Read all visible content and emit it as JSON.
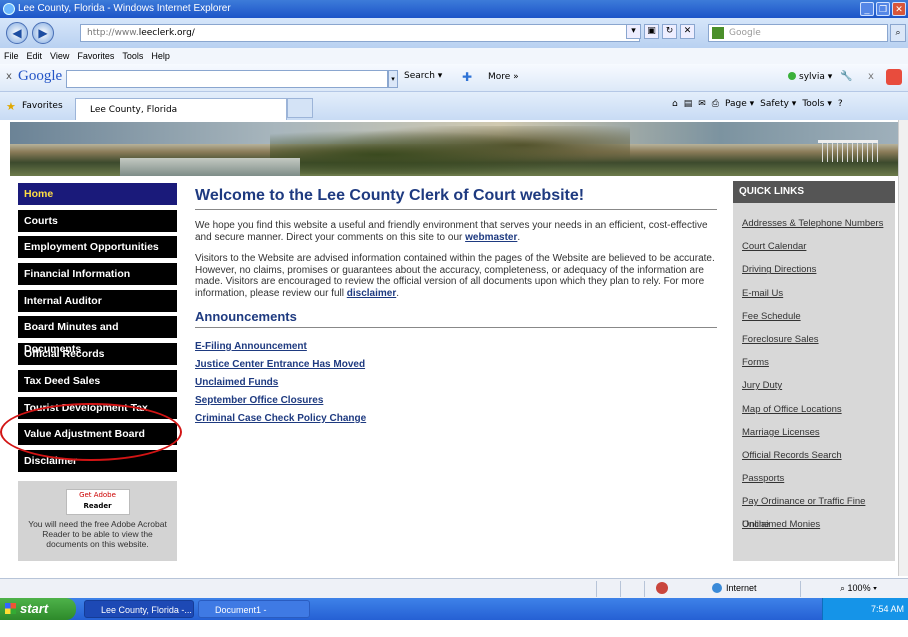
{
  "window": {
    "title": "Lee County, Florida - Windows Internet Explorer",
    "controls": [
      "_",
      "❐",
      "✕"
    ]
  },
  "address_bar": {
    "url_prefix": "http://www.",
    "url_host": "leeclerk.org/",
    "search_placeholder": "Google"
  },
  "menu": [
    "File",
    "Edit",
    "View",
    "Favorites",
    "Tools",
    "Help"
  ],
  "google_bar": {
    "logo": "Google",
    "search_label": "Search ▾",
    "more_label": "More »",
    "user": "sylvia ▾"
  },
  "favorites_bar": {
    "favorites_label": "Favorites",
    "tab_title": "Lee County, Florida",
    "commands": [
      "Page ▾",
      "Safety ▾",
      "Tools ▾"
    ]
  },
  "left_nav": {
    "items": [
      "Home",
      "Courts",
      "Employment Opportunities",
      "Financial Information",
      "Internal Auditor",
      "Board Minutes and Documents",
      "Official Records",
      "Tax Deed Sales",
      "Tourist Development Tax",
      "Value Adjustment Board",
      "Disclaimer"
    ],
    "adobe": {
      "get": "Get Adobe",
      "reader": "Reader",
      "note": "You will need the free Adobe Acrobat Reader to be able to view the documents on this website."
    }
  },
  "main": {
    "title": "Welcome to the Lee County Clerk of Court website!",
    "p1_text": "We hope you find this website a useful and friendly environment that serves your needs in an efficient, cost-effective and secure manner. Direct your comments on this site to our ",
    "p1_link": "webmaster",
    "p1_end": ".",
    "p2_text": "Visitors to the Website are advised information contained within the pages of the Website are believed to be accurate. However, no claims, promises or guarantees about the accuracy, completeness, or adequacy of the information are made. Visitors are encouraged to review the official version of all documents upon which they plan to rely. For more information, please review our full ",
    "p2_link": "disclaimer",
    "p2_end": ".",
    "announcements_title": "Announcements",
    "announcements": [
      "E-Filing Announcement",
      "Justice Center Entrance Has Moved",
      "Unclaimed Funds",
      "September Office Closures",
      "Criminal Case Check Policy Change"
    ]
  },
  "quick_links": {
    "title": "QUICK LINKS",
    "items": [
      "Addresses & Telephone Numbers",
      "Court Calendar",
      "Driving Directions",
      "E-mail Us",
      "Fee Schedule",
      "Foreclosure Sales",
      "Forms",
      "Jury Duty",
      "Map of Office Locations",
      "Marriage Licenses",
      "Official Records Search",
      "Passports",
      "Pay Ordinance or Traffic Fine Online",
      "Unclaimed Monies"
    ]
  },
  "status_bar": {
    "zone": "Internet",
    "zoom": "100%"
  },
  "taskbar": {
    "start": "start",
    "tasks": [
      "Lee County, Florida -...",
      "Document1 - Microsof..."
    ],
    "time": "7:54 AM"
  },
  "colors": {
    "nav_bg": "#000000",
    "heading": "#1e3a80",
    "quick_bg": "#d8d8d8",
    "annotation_circle": "#d21414"
  }
}
